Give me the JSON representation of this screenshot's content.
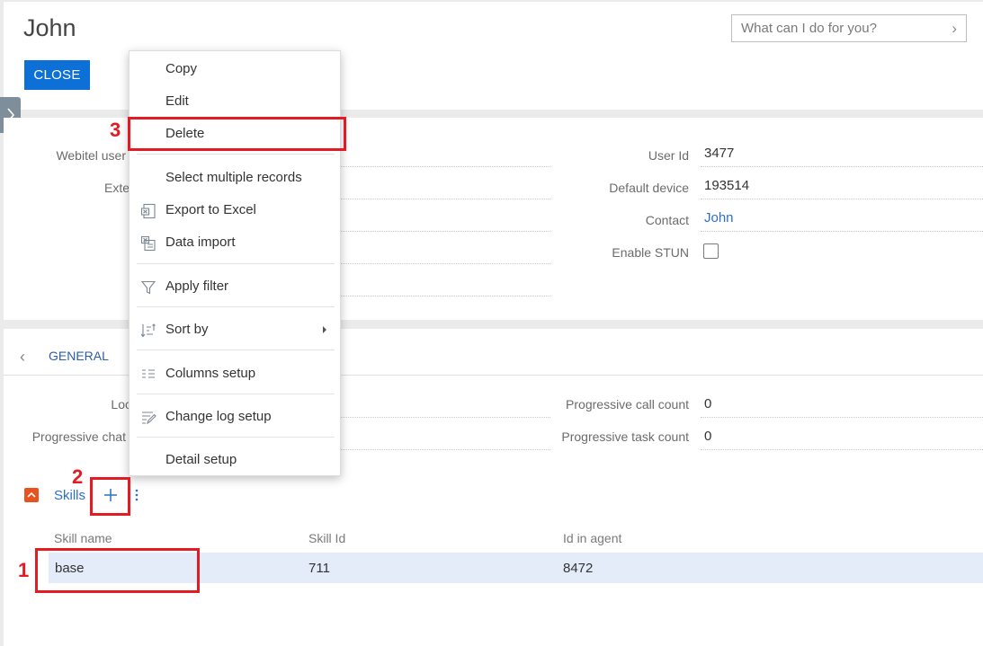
{
  "header": {
    "title": "John",
    "close_label": "CLOSE",
    "search_placeholder": "What can I do for you?"
  },
  "user_fields": {
    "left": [
      {
        "label": "Webitel user",
        "value": ""
      },
      {
        "label": "Exte",
        "value": ""
      }
    ],
    "right": [
      {
        "label": "User Id",
        "value": "3477"
      },
      {
        "label": "Default device",
        "value": "193514"
      },
      {
        "label": "Contact",
        "value": "John"
      },
      {
        "label": "Enable STUN",
        "value": false
      }
    ]
  },
  "general": {
    "tab_label": "GENERAL",
    "left": [
      {
        "label": "Loc",
        "value": ""
      },
      {
        "label": "Progressive chat",
        "value": ""
      }
    ],
    "right": [
      {
        "label": "Progressive call count",
        "value": "0"
      },
      {
        "label": "Progressive task count",
        "value": "0"
      }
    ]
  },
  "skills": {
    "title": "Skills",
    "columns": [
      "Skill name",
      "Skill Id",
      "Id in agent"
    ],
    "rows": [
      {
        "name": "base",
        "skill_id": "711",
        "agent_id": "8472"
      }
    ]
  },
  "context_menu": {
    "items": [
      {
        "label": "Copy",
        "icon": ""
      },
      {
        "label": "Edit",
        "icon": ""
      },
      {
        "label": "Delete",
        "icon": ""
      },
      {
        "label": "Select multiple records",
        "icon": ""
      },
      {
        "label": "Export to Excel",
        "icon": "excel-export-icon"
      },
      {
        "label": "Data import",
        "icon": "data-import-icon"
      },
      {
        "label": "Apply filter",
        "icon": "filter-icon"
      },
      {
        "label": "Sort by",
        "icon": "sort-icon"
      },
      {
        "label": "Columns setup",
        "icon": "columns-icon"
      },
      {
        "label": "Change log setup",
        "icon": "change-log-icon"
      },
      {
        "label": "Detail setup",
        "icon": ""
      }
    ]
  },
  "annotations": {
    "markers": [
      "1",
      "2",
      "3"
    ],
    "color": "#e31b23"
  },
  "colors": {
    "accent": "#0c70d6",
    "link": "#2c6fc9",
    "skills_toggle": "#e8521e",
    "row_highlight": "#e3ecf8"
  }
}
